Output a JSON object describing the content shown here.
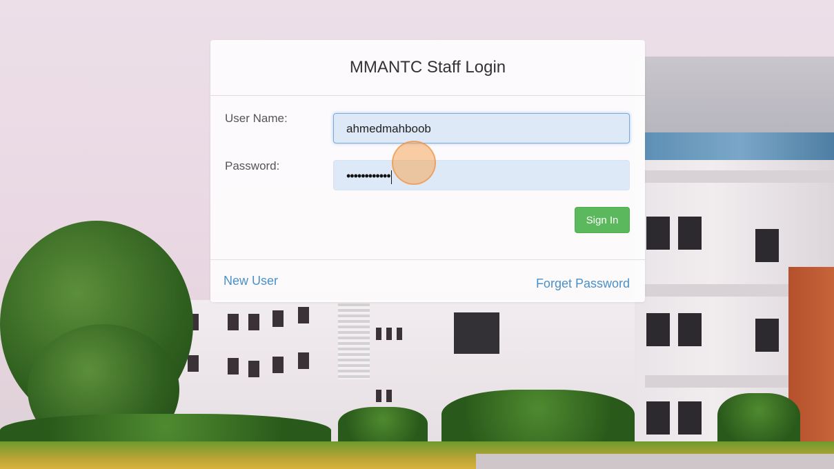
{
  "login": {
    "title": "MMANTC Staff Login",
    "username_label": "User Name:",
    "username_value": "ahmedmahboob",
    "password_label": "Password:",
    "password_masked": "••••••••••••",
    "signin_label": "Sign In",
    "new_user_label": "New User",
    "forget_password_label": "Forget Password"
  },
  "colors": {
    "signin_button": "#5cb85c",
    "link": "#4a90c8",
    "input_fill": "#dde9f6"
  }
}
